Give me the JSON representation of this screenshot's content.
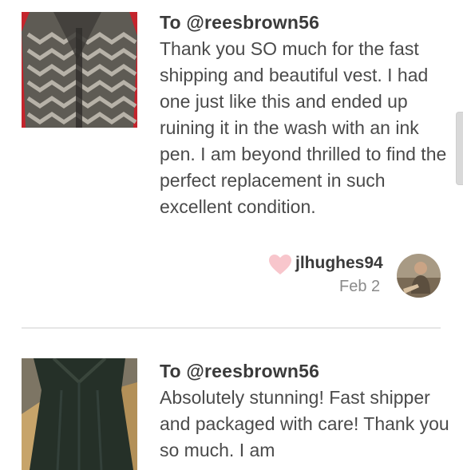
{
  "reviews": [
    {
      "recipient": "To @reesbrown56",
      "message": "Thank you SO much for the fast shipping and beautiful vest. I had one just like this and ended up ruining it in the wash with an ink pen. I am beyond thrilled to find the perfect replacement in such excellent condition.",
      "author": "jlhughes94",
      "date": "Feb 2",
      "icons": {
        "like": "heart-icon"
      }
    },
    {
      "recipient": "To @reesbrown56",
      "message": "Absolutely stunning! Fast shipper and packaged with care! Thank you so much. I am"
    }
  ],
  "colors": {
    "heart": "#f8c6cc",
    "divider": "#e6e6e6",
    "text": "#4a4a4a",
    "muted": "#8a8a8a"
  }
}
